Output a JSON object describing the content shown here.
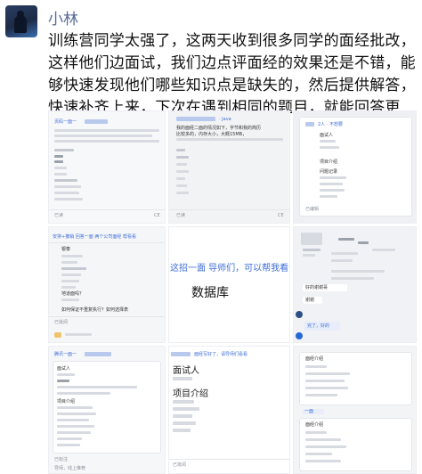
{
  "post": {
    "username": "小林",
    "text": "训练营同学太强了，这两天收到很多同学的面经批改，这样他们边面试，我们边点评面经的效果还是不错，能够快速发现他们哪些知识点是缺失的，然后提供解答，快速补齐上来，下次在遇到相同的题目，就能回答更好。"
  },
  "thumbs": {
    "t1": {
      "header": "页码一面一 ",
      "footer_left": "已读",
      "footer_right": "CE"
    },
    "t2": {
      "header": "· Java",
      "body_line1": "我的面经二面的情况如下，字节和我的简历",
      "body_line2": "比较多的，内存大小，大概15MB，",
      "footer_left": "已读",
      "footer_right": "CE"
    },
    "t3": {
      "header": "2人 · 不想要",
      "label_a": "面试人",
      "label_b": "项目介绍",
      "label_c": "问题记录",
      "footer": "已编辑"
    },
    "t4": {
      "top_line": "安排+撤销 回答一面 两个公司面经 帮看看",
      "label_1": "银泰",
      "label_2": "地道面吗？",
      "label_3": "如何保证不重复执行？如何选择表",
      "footer": "已批阅"
    },
    "t5": {
      "line_1": "这招一面 导师们，可以帮我看",
      "line_2": "数据库"
    },
    "t6": {
      "bubble_1": "好的谢谢哥",
      "bubble_2": "谢谢",
      "bubble_3": "完了，好的"
    },
    "t7": {
      "header": "腾讯一面一",
      "label_1": "面试人",
      "label_2": "项目介绍",
      "footer_left": "已标注",
      "footer_mid": "导师，线上推荐"
    },
    "t8": {
      "header": "面经写好了，请导师们看看",
      "label_1": "面试人",
      "label_2": "项目介绍",
      "footer": "已批阅"
    },
    "t9": {
      "label_1": "面经介绍",
      "label_2": "面经介绍",
      "footer": "一面"
    }
  }
}
